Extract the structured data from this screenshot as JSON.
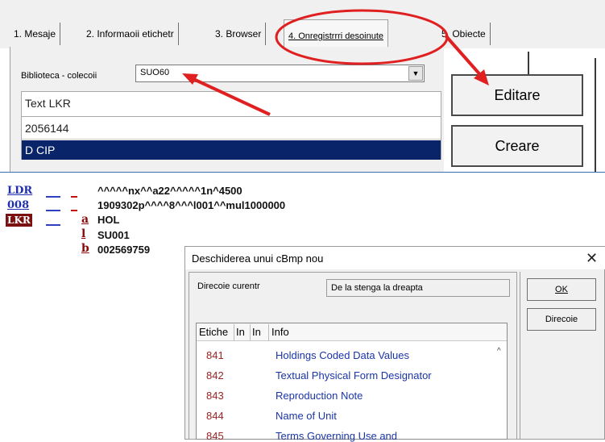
{
  "tabs": [
    {
      "label": "1. Mesaje"
    },
    {
      "label": "2. Informaoii etichetr"
    },
    {
      "label": "3. Browser"
    },
    {
      "label": "4. Onregistrrri desoinute"
    },
    {
      "label": "5. Obiecte"
    }
  ],
  "collection": {
    "label": "Biblioteca - colecoii",
    "value": "SUO60"
  },
  "list": {
    "header": "Text LKR",
    "rows": [
      "2056144",
      "D CIP"
    ]
  },
  "buttons": {
    "edit": "Editare",
    "create": "Creare"
  },
  "record": {
    "ldr": {
      "tag": "LDR",
      "value": "^^^^^nx^^a22^^^^^1n^4500"
    },
    "f008": {
      "tag": "008",
      "value": "1909302p^^^^8^^^l001^^mul1000000"
    },
    "lkr": {
      "tag": "LKR",
      "subfields": [
        {
          "code": "a",
          "value": "HOL"
        },
        {
          "code": "l",
          "value": "SU001"
        },
        {
          "code": "b",
          "value": "002569759"
        }
      ]
    }
  },
  "dialog": {
    "title": "Deschiderea unui cBmp nou",
    "direction_label": "Direcoie curentr",
    "direction_value": "De la stenga la dreapta",
    "ok_label": "OK",
    "direction_button": "Direcoie",
    "columns": [
      "Etiche",
      "In",
      "In",
      "Info"
    ],
    "fields": [
      {
        "code": "841",
        "name": "Holdings Coded Data Values"
      },
      {
        "code": "842",
        "name": "Textual Physical Form Designator"
      },
      {
        "code": "843",
        "name": "Reproduction Note"
      },
      {
        "code": "844",
        "name": "Name of Unit"
      },
      {
        "code": "845",
        "name": "Terms Governing Use and"
      }
    ]
  },
  "colors": {
    "selection": "#0a246a",
    "annotation": "#e02020",
    "tag_link": "#1f2fb0",
    "tag_active_bg": "#7a1010",
    "subfield": "#8a0a0a"
  }
}
